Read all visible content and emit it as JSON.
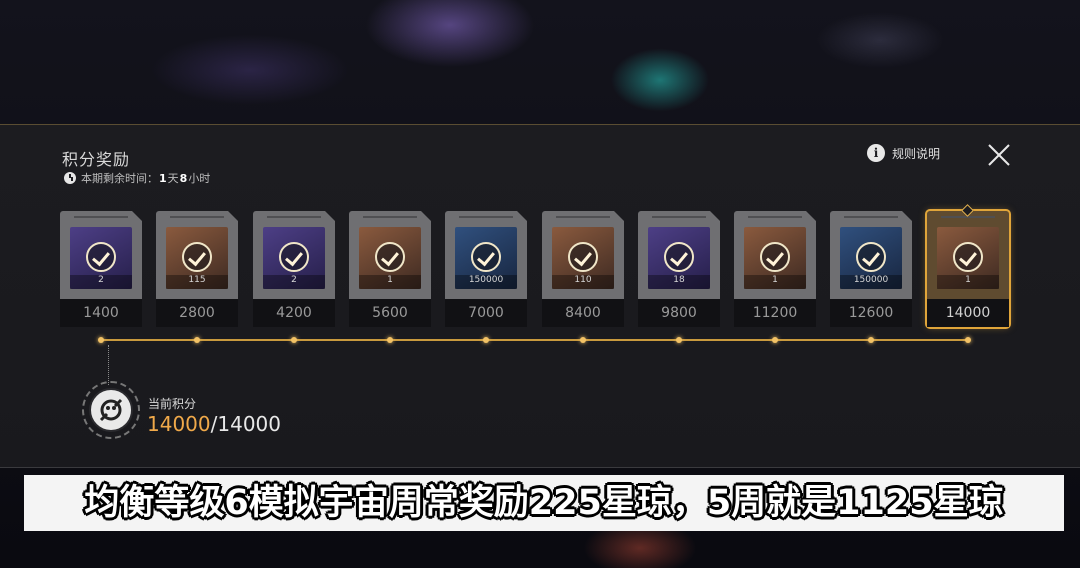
{
  "panel": {
    "title": "积分奖励",
    "timer": {
      "prefix": "本期剩余时间：",
      "days": "1",
      "day_unit": "天",
      "hours": "8",
      "hour_unit": "小时"
    },
    "rules_label": "规则说明",
    "icons": {
      "timer": "clock-icon",
      "rules": "info-icon",
      "close": "close-icon"
    }
  },
  "rewards": [
    {
      "points": "1400",
      "quantity": "2",
      "art": "purple",
      "claimed": true
    },
    {
      "points": "2800",
      "quantity": "115",
      "art": "brown",
      "claimed": true
    },
    {
      "points": "4200",
      "quantity": "2",
      "art": "purple",
      "claimed": true
    },
    {
      "points": "5600",
      "quantity": "1",
      "art": "brown",
      "claimed": true
    },
    {
      "points": "7000",
      "quantity": "150000",
      "art": "blue",
      "claimed": true
    },
    {
      "points": "8400",
      "quantity": "110",
      "art": "brown",
      "claimed": true
    },
    {
      "points": "9800",
      "quantity": "18",
      "art": "purple",
      "claimed": true
    },
    {
      "points": "11200",
      "quantity": "1",
      "art": "brown",
      "claimed": true
    },
    {
      "points": "12600",
      "quantity": "150000",
      "art": "blue",
      "claimed": true
    },
    {
      "points": "14000",
      "quantity": "1",
      "art": "brown",
      "claimed": true,
      "selected": true
    }
  ],
  "score": {
    "label": "当前积分",
    "current": "14000",
    "separator": "/",
    "max": "14000"
  },
  "caption": "均衡等级6模拟宇宙周常奖励225星琼，5周就是1125星琼",
  "colors": {
    "accent_gold": "#e0a53a",
    "score_orange": "#f0a94a",
    "panel_bg": "#1c1c20"
  }
}
